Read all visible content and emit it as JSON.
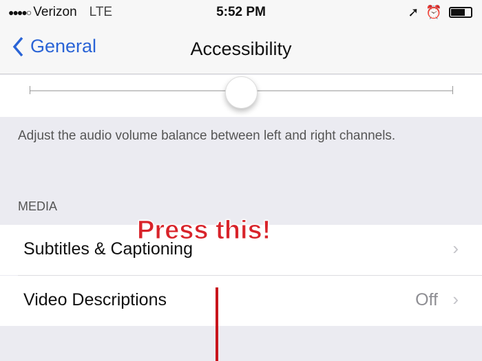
{
  "status_bar": {
    "signal": "●●●●○",
    "carrier": "Verizon",
    "network": "LTE",
    "time": "5:52 PM",
    "icons": [
      "location-icon",
      "alarm-icon",
      "battery-icon"
    ]
  },
  "nav": {
    "back_label": "General",
    "title": "Accessibility"
  },
  "balance_slider": {
    "value": 0.5,
    "footer": "Adjust the audio volume balance between left and right channels."
  },
  "media": {
    "header": "MEDIA",
    "rows": [
      {
        "label": "Subtitles & Captioning",
        "value": ""
      },
      {
        "label": "Video Descriptions",
        "value": "Off"
      }
    ]
  },
  "annotation": {
    "text": "Press this!",
    "color": "#d8232a"
  },
  "colors": {
    "accent": "#2a64d6",
    "background": "#ebebf1"
  }
}
